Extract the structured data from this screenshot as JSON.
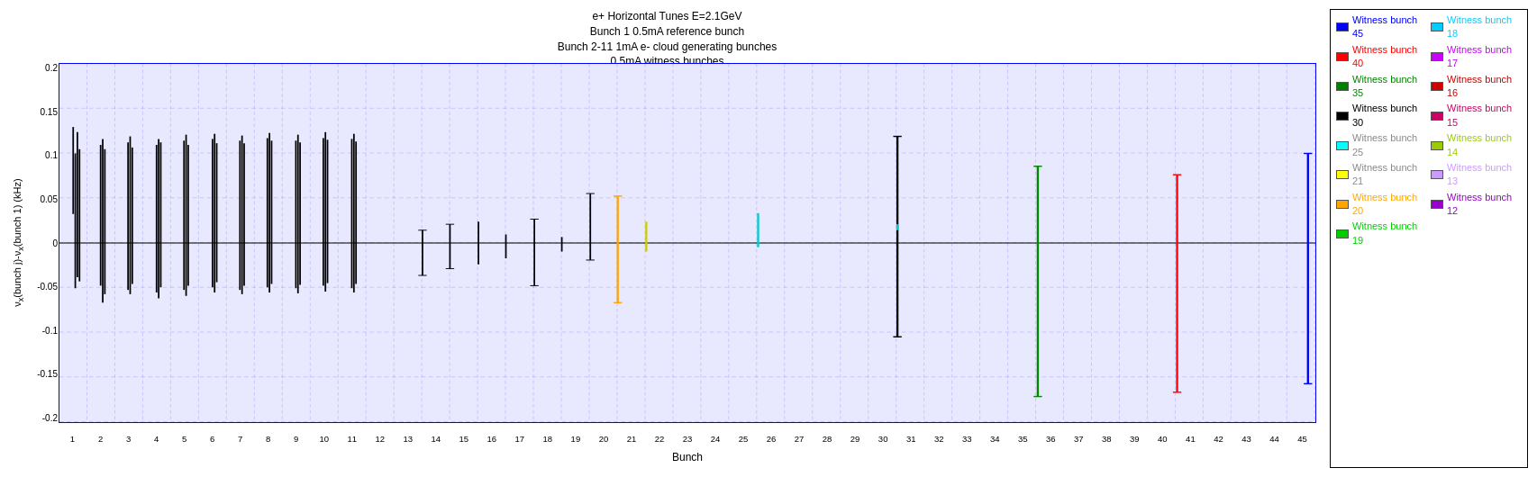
{
  "title": {
    "line1": "e+ Horizontal Tunes E=2.1GeV",
    "line2": "Bunch 1 0.5mA reference bunch",
    "line3": "Bunch 2-11 1mA e- cloud generating bunches",
    "line4": "0.5mA witness bunches"
  },
  "yaxis": {
    "label": "νx(bunch j)-νx(bunch 1) (kHz)",
    "ticks": [
      "0.2",
      "0.15",
      "0.1",
      "0.05",
      "0",
      "-0.05",
      "-0.1",
      "-0.15",
      "-0.2"
    ]
  },
  "xaxis": {
    "label": "Bunch",
    "ticks": [
      "1",
      "2",
      "3",
      "4",
      "5",
      "6",
      "7",
      "8",
      "9",
      "10",
      "11",
      "12",
      "13",
      "14",
      "15",
      "16",
      "17",
      "18",
      "19",
      "20",
      "21",
      "22",
      "23",
      "24",
      "25",
      "26",
      "27",
      "28",
      "29",
      "30",
      "31",
      "32",
      "33",
      "34",
      "35",
      "36",
      "37",
      "38",
      "39",
      "40",
      "41",
      "42",
      "43",
      "44",
      "45"
    ]
  },
  "legend": {
    "items": [
      {
        "label": "Witness bunch 45",
        "color": "#0000ff"
      },
      {
        "label": "Witness bunch 40",
        "color": "#ff0000"
      },
      {
        "label": "Witness bunch 35",
        "color": "#008000"
      },
      {
        "label": "Witness bunch 30",
        "color": "#000000"
      },
      {
        "label": "Witness bunch 25",
        "color": "#00ffff"
      },
      {
        "label": "Witness bunch 21",
        "color": "#ffff00"
      },
      {
        "label": "Witness bunch 20",
        "color": "#ffa500"
      },
      {
        "label": "Witness bunch 19",
        "color": "#00cc00"
      },
      {
        "label": "Witness bunch 18",
        "color": "#00ccff"
      },
      {
        "label": "Witness bunch 17",
        "color": "#cc00ff"
      },
      {
        "label": "Witness bunch 16",
        "color": "#cc0000"
      },
      {
        "label": "Witness bunch 15",
        "color": "#cc0066"
      },
      {
        "label": "Witness bunch 14",
        "color": "#99cc00"
      },
      {
        "label": "Witness bunch 13",
        "color": "#cc99ff"
      },
      {
        "label": "Witness bunch 12",
        "color": "#9900cc"
      }
    ]
  }
}
